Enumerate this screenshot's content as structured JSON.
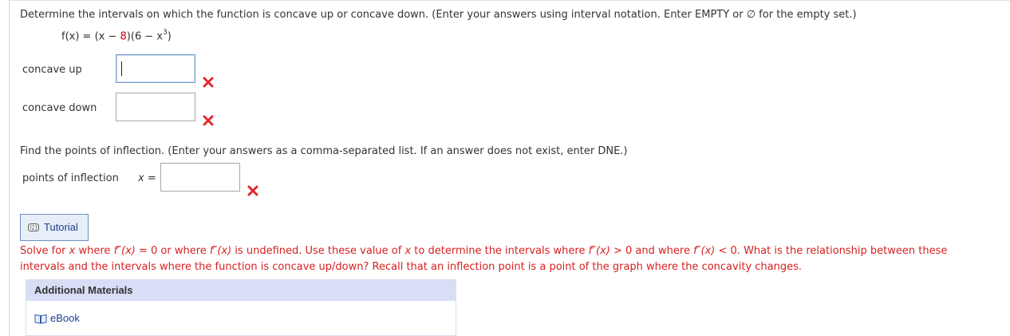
{
  "question1": {
    "prompt": "Determine the intervals on which the function is concave up or concave down. (Enter your answers using interval notation. Enter EMPTY or ∅ for the empty set.)",
    "formula": {
      "lhs": "f(x)",
      "eq": " = (x − ",
      "const_red": "8",
      "mid": ")(6 − x",
      "exp": "3",
      "end": ")"
    },
    "concave_up": {
      "label": "concave up",
      "value": ""
    },
    "concave_down": {
      "label": "concave down",
      "value": ""
    }
  },
  "question2": {
    "prompt": "Find the points of inflection. (Enter your answers as a comma-separated list. If an answer does not exist, enter DNE.)",
    "points_label": "points of inflection",
    "var_label": "x",
    "eq_sign": " =",
    "value": ""
  },
  "tutorial": {
    "label": "Tutorial",
    "icon": "tutorial-123-icon"
  },
  "hint": {
    "part1": "Solve for ",
    "x1": "x",
    "part2": " where ",
    "f1": "f″(x)",
    "part3": " = 0 or where ",
    "f2": "f″(x)",
    "part4": " is undefined. Use these value of ",
    "x2": "x",
    "part5": " to determine the intervals where ",
    "f3": "f″(x)",
    "part6": " > 0 and where ",
    "f4": "f″(x)",
    "part7": " < 0. What is the relationship between these intervals and the intervals where the function is concave up/down? Recall that an inflection point is a point of the graph where the concavity changes."
  },
  "additional_materials": {
    "title": "Additional Materials",
    "ebook_label": "eBook"
  },
  "status": {
    "incorrect_icon": "red-x-icon"
  },
  "colors": {
    "error_red": "#d62020",
    "link_blue": "#1a3d8f",
    "header_bg": "#d8def5"
  }
}
